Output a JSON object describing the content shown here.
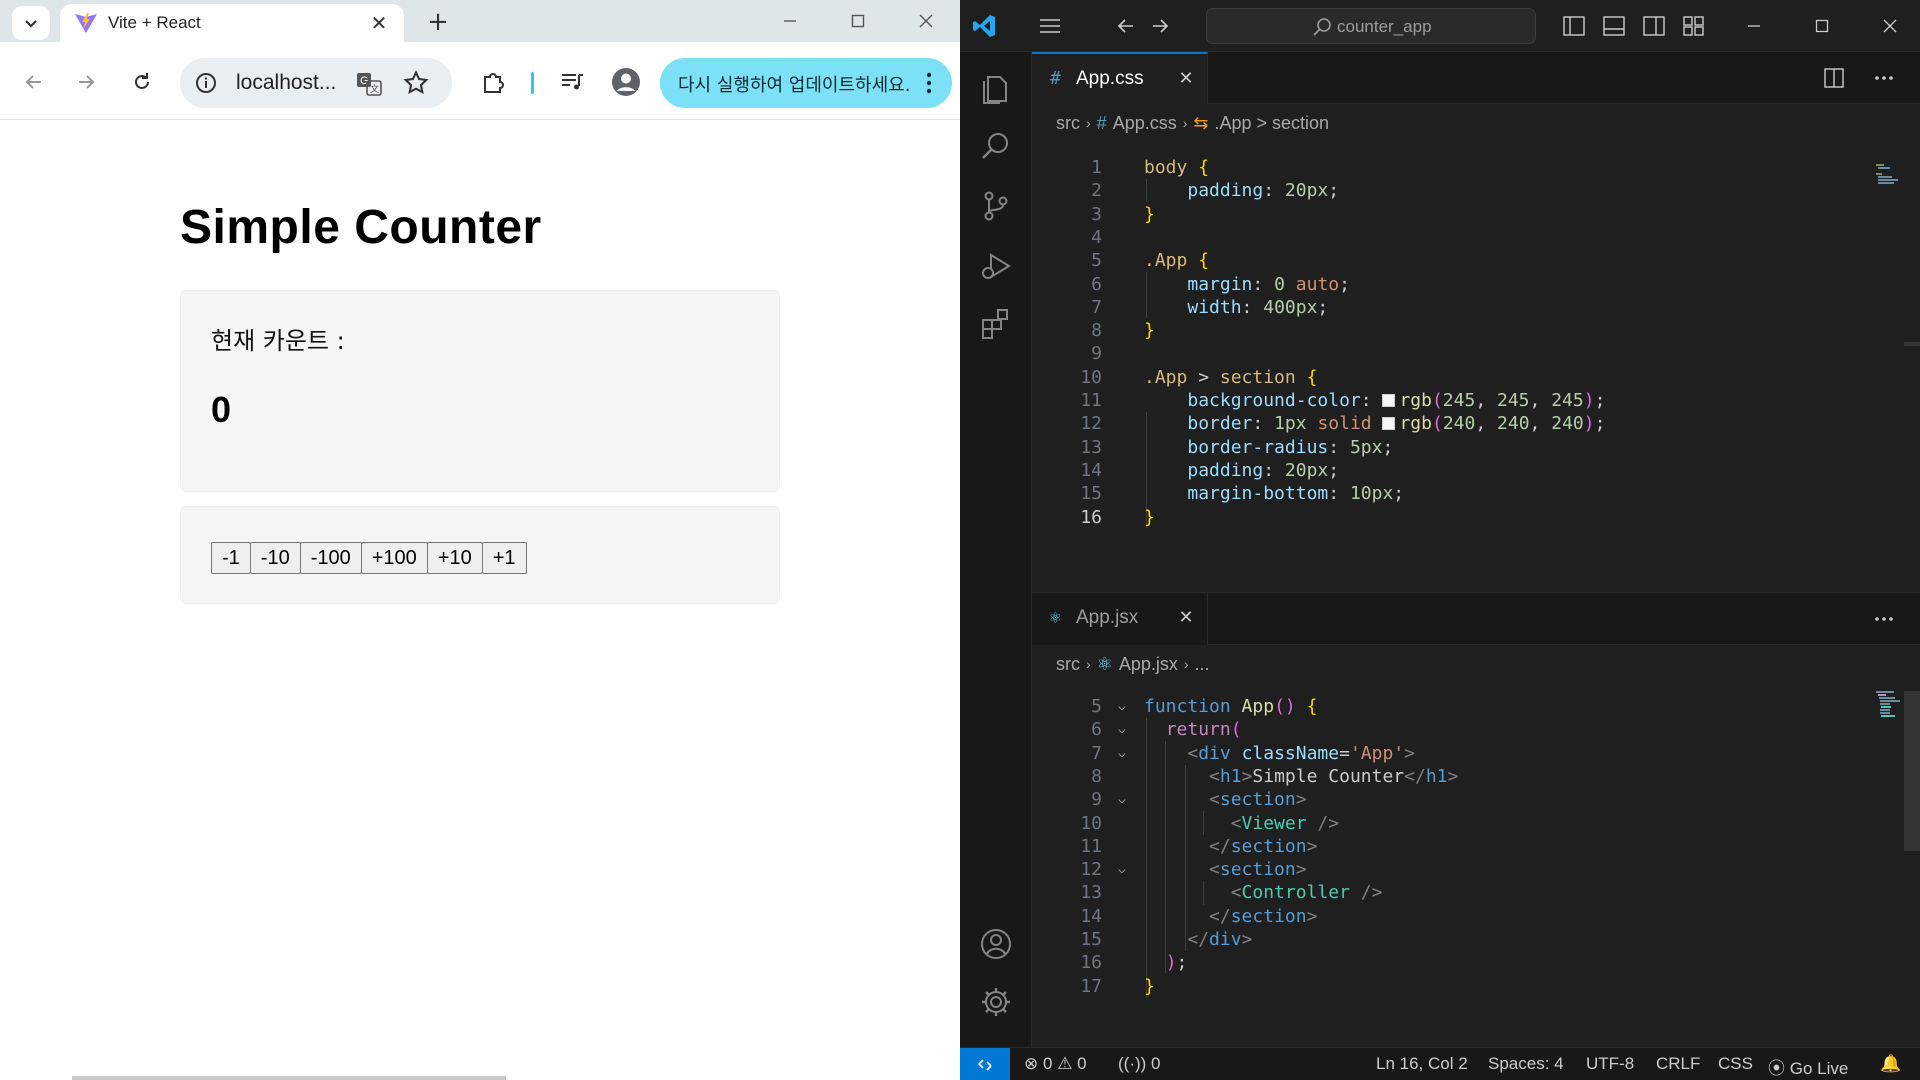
{
  "browser": {
    "tab_title": "Vite + React",
    "url": "localhost...",
    "update_button": "다시 실행하여 업데이트하세요."
  },
  "page": {
    "title": "Simple Counter",
    "count_label": "현재 카운트 :",
    "count_value": "0",
    "buttons": [
      "-1",
      "-10",
      "-100",
      "+100",
      "+10",
      "+1"
    ]
  },
  "vscode": {
    "search": "counter_app",
    "colors": {
      "accent": "#0078d4",
      "background": "#1f1f1f"
    },
    "editor_top": {
      "tab_label": "App.css",
      "breadcrumb": [
        "src",
        "App.css",
        ".App > section"
      ],
      "lines": [
        {
          "n": "1",
          "code": "body {"
        },
        {
          "n": "2",
          "code": "    padding: 20px;"
        },
        {
          "n": "3",
          "code": "}"
        },
        {
          "n": "4",
          "code": ""
        },
        {
          "n": "5",
          "code": ".App {"
        },
        {
          "n": "6",
          "code": "    margin: 0 auto;"
        },
        {
          "n": "7",
          "code": "    width: 400px;"
        },
        {
          "n": "8",
          "code": "}"
        },
        {
          "n": "9",
          "code": ""
        },
        {
          "n": "10",
          "code": ".App > section {"
        },
        {
          "n": "11",
          "code": "    background-color: rgb(245, 245, 245);"
        },
        {
          "n": "12",
          "code": "    border: 1px solid rgb(240, 240, 240);"
        },
        {
          "n": "13",
          "code": "    border-radius: 5px;"
        },
        {
          "n": "14",
          "code": "    padding: 20px;"
        },
        {
          "n": "15",
          "code": "    margin-bottom: 10px;"
        },
        {
          "n": "16",
          "code": "}"
        }
      ]
    },
    "editor_bottom": {
      "tab_label": "App.jsx",
      "breadcrumb": [
        "src",
        "App.jsx",
        "..."
      ],
      "lines": [
        {
          "n": "5",
          "code": "function App() {"
        },
        {
          "n": "6",
          "code": "  return("
        },
        {
          "n": "7",
          "code": "    <div className='App'>"
        },
        {
          "n": "8",
          "code": "      <h1>Simple Counter</h1>"
        },
        {
          "n": "9",
          "code": "      <section>"
        },
        {
          "n": "10",
          "code": "        <Viewer />"
        },
        {
          "n": "11",
          "code": "      </section>"
        },
        {
          "n": "12",
          "code": "      <section>"
        },
        {
          "n": "13",
          "code": "        <Controller />"
        },
        {
          "n": "14",
          "code": "      </section>"
        },
        {
          "n": "15",
          "code": "    </div>"
        },
        {
          "n": "16",
          "code": "  );"
        },
        {
          "n": "17",
          "code": "}"
        }
      ]
    },
    "status": {
      "errors": "0",
      "warnings": "0",
      "ports": "0",
      "position": "Ln 16, Col 2",
      "spaces": "Spaces: 4",
      "encoding": "UTF-8",
      "eol": "CRLF",
      "language": "CSS",
      "golive": "Go Live"
    }
  }
}
